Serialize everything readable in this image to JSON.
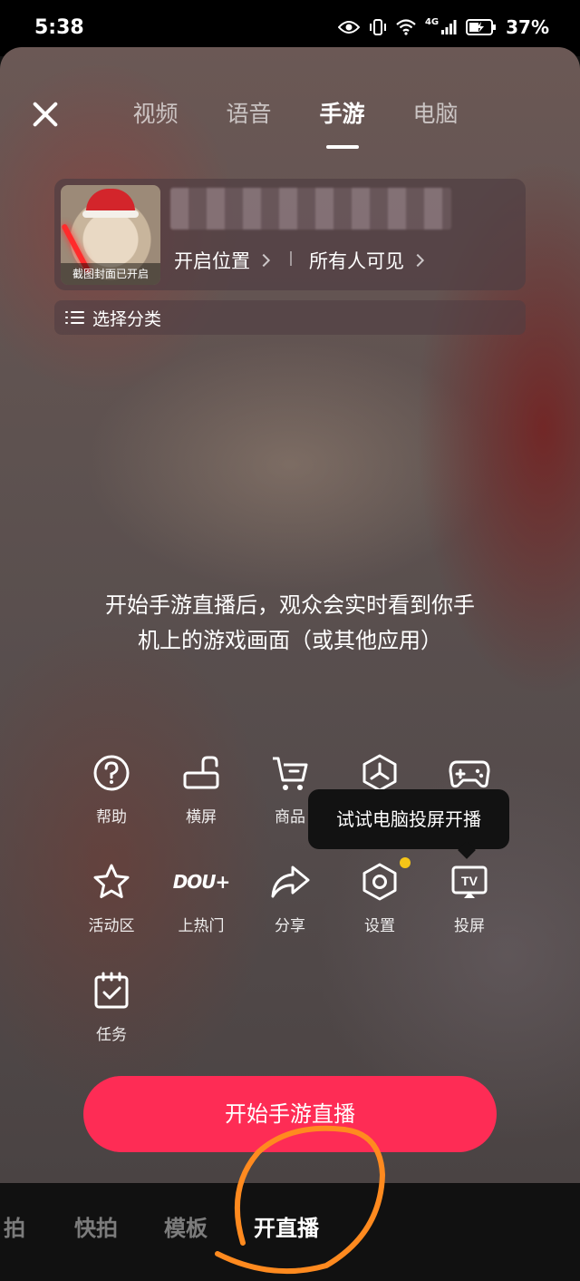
{
  "status": {
    "time": "5:38",
    "battery": "37%",
    "network": "4G"
  },
  "header": {
    "tabs": [
      {
        "label": "视频"
      },
      {
        "label": "语音"
      },
      {
        "label": "手游"
      },
      {
        "label": "电脑"
      }
    ],
    "active_tab": "手游"
  },
  "cover": {
    "caption": "截图封面已开启",
    "location_label": "开启位置",
    "visibility_label": "所有人可见"
  },
  "category": {
    "label": "选择分类"
  },
  "description": "开始手游直播后，观众会实时看到你手机上的游戏画面（或其他应用）",
  "tools": {
    "help": "帮助",
    "landscape": "横屏",
    "goods": "商品",
    "activity": "活动区",
    "dou_hot": "上热门",
    "dou_logo": "DOU+",
    "share": "分享",
    "settings": "设置",
    "cast": "投屏",
    "task": "任务"
  },
  "tooltip": {
    "text": "试试电脑投屏开播"
  },
  "start_button": {
    "label": "开始手游直播"
  },
  "bottom_nav": {
    "items": [
      {
        "label": "拍"
      },
      {
        "label": "快拍"
      },
      {
        "label": "模板"
      },
      {
        "label": "开直播"
      }
    ],
    "active": "开直播"
  },
  "colors": {
    "accent": "#fe2c55",
    "badge_dot": "#f5c518",
    "annotation": "#ff8a1f"
  }
}
